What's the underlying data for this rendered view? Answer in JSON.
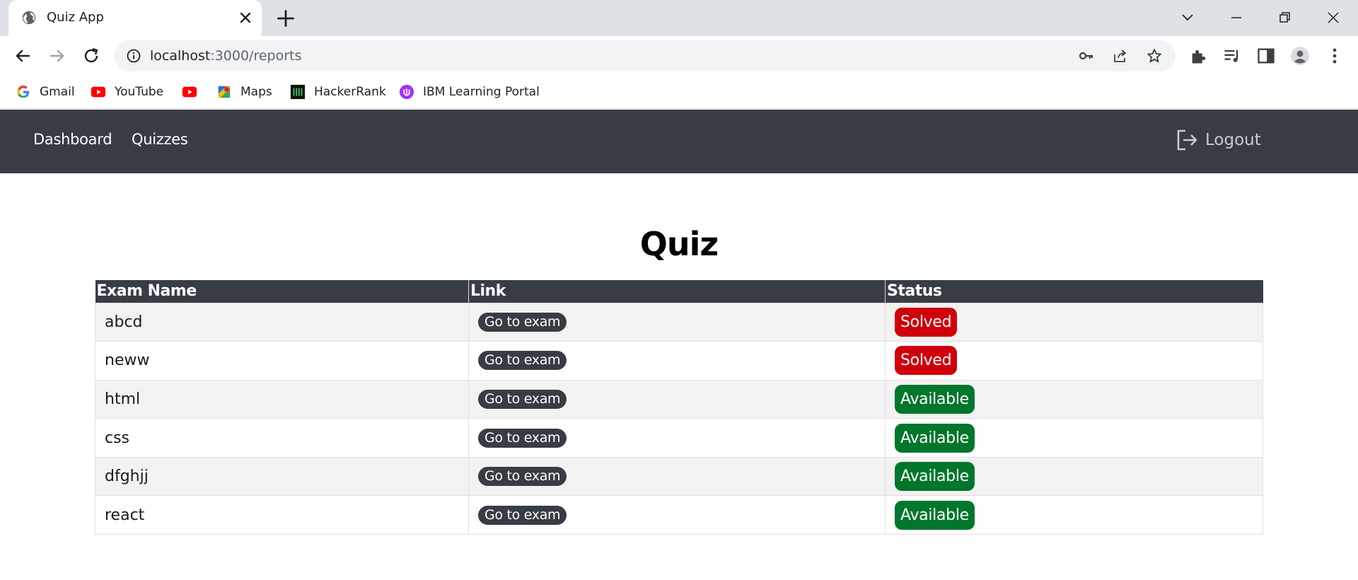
{
  "browser": {
    "tab_title": "Quiz App",
    "url_host": "localhost",
    "url_path": ":3000/reports"
  },
  "bookmarks": [
    {
      "label": "Gmail",
      "icon": "google-icon"
    },
    {
      "label": "YouTube",
      "icon": "youtube-icon"
    },
    {
      "label": "",
      "icon": "youtube-icon"
    },
    {
      "label": "Maps",
      "icon": "maps-icon"
    },
    {
      "label": "HackerRank",
      "icon": "hackerrank-icon"
    },
    {
      "label": "IBM Learning Portal",
      "icon": "ibm-learning-icon"
    }
  ],
  "navbar": {
    "links": [
      "Dashboard",
      "Quizzes"
    ],
    "logout_label": "Logout"
  },
  "page": {
    "title": "Quiz"
  },
  "table": {
    "headers": [
      "Exam Name",
      "Link",
      "Status"
    ],
    "rows": [
      {
        "name": "abcd",
        "link": "Go to exam",
        "status": "Solved"
      },
      {
        "name": "neww",
        "link": "Go to exam",
        "status": "Solved"
      },
      {
        "name": "html",
        "link": "Go to exam",
        "status": "Available"
      },
      {
        "name": "css",
        "link": "Go to exam",
        "status": "Available"
      },
      {
        "name": "dfghjj",
        "link": "Go to exam",
        "status": "Available"
      },
      {
        "name": "react",
        "link": "Go to exam",
        "status": "Available"
      }
    ]
  },
  "colors": {
    "navbar_bg": "#383c45",
    "solved": "#d0000b",
    "available": "#00772d",
    "row_alt": "#f2f2f2"
  }
}
